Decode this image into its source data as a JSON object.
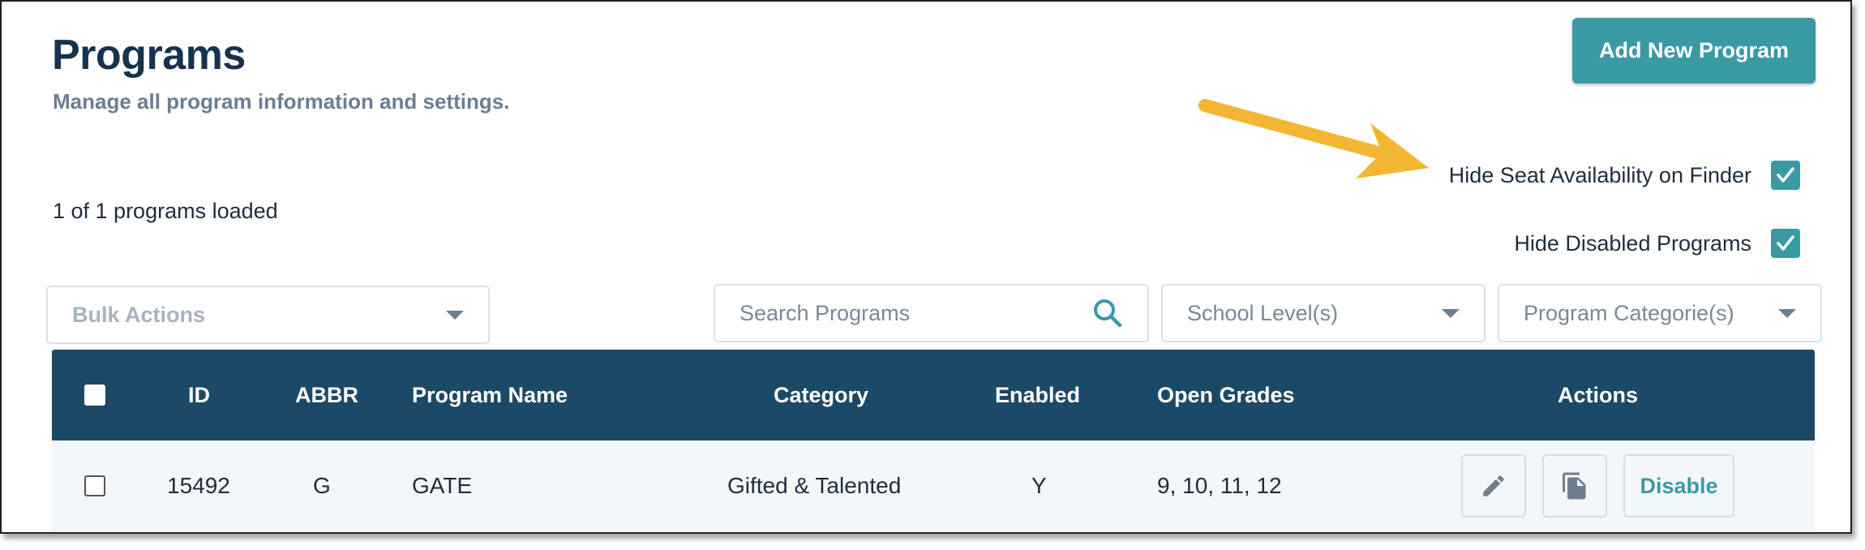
{
  "header": {
    "title": "Programs",
    "subtitle": "Manage all program information and settings.",
    "add_button_label": "Add New Program"
  },
  "toggles": {
    "hide_seat": {
      "label": "Hide Seat Availability on Finder",
      "checked": true
    },
    "hide_disabled": {
      "label": "Hide Disabled Programs",
      "checked": true
    }
  },
  "status": {
    "loaded_text": "1 of 1 programs loaded"
  },
  "filters": {
    "bulk_actions": "Bulk Actions",
    "search_placeholder": "Search Programs",
    "school_level": "School Level(s)",
    "program_category": "Program Categorie(s)"
  },
  "table": {
    "columns": {
      "id": "ID",
      "abbr": "ABBR",
      "name": "Program Name",
      "category": "Category",
      "enabled": "Enabled",
      "open_grades": "Open Grades",
      "actions": "Actions"
    },
    "rows": [
      {
        "id": "15492",
        "abbr": "G",
        "name": "GATE",
        "category": "Gifted & Talented",
        "enabled": "Y",
        "open_grades": "9, 10, 11, 12",
        "disable_label": "Disable"
      }
    ]
  },
  "colors": {
    "accent": "#3a9aa4",
    "header_bg": "#1c4966",
    "annotation_arrow": "#f2b632"
  },
  "icons": [
    "search-icon",
    "chevron-down-icon",
    "pencil-icon",
    "copy-icon",
    "checkmark-icon",
    "annotation-arrow"
  ]
}
